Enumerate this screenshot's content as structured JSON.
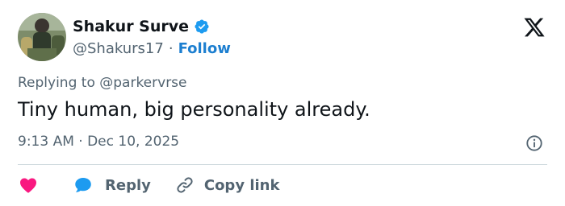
{
  "author": {
    "display_name": "Shakur Surve",
    "handle": "@Shakurs17",
    "separator": "·",
    "follow_label": "Follow"
  },
  "tweet": {
    "replying_to": "Replying to @parkervrse",
    "text": "Tiny human, big personality already.",
    "timestamp": "9:13 AM · Dec 10, 2025"
  },
  "actions": {
    "reply_label": "Reply",
    "copy_link_label": "Copy link"
  },
  "colors": {
    "text_primary": "#0f1419",
    "text_secondary": "#536471",
    "link_blue": "#1d7fd0",
    "verified_blue": "#1d9bf0",
    "like_pink": "#f91880",
    "divider": "#cfd9de"
  },
  "icons": {
    "verified": "verified-badge-icon",
    "logo": "x-logo-icon",
    "info": "info-icon",
    "like": "heart-icon",
    "reply": "speech-bubble-icon",
    "copy_link": "link-icon"
  }
}
